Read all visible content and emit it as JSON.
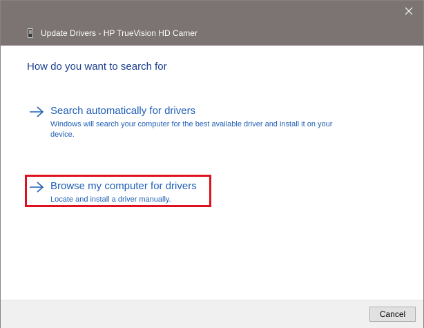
{
  "window": {
    "title": "Update Drivers - HP TrueVision HD Camer",
    "title_icon": "device-icon",
    "close_icon": "close-icon"
  },
  "main": {
    "heading": "How do you want to search for",
    "options": [
      {
        "icon": "arrow-right-icon",
        "title": "Search automatically for drivers",
        "description": "Windows will search your computer for the best available driver and install it on your device."
      },
      {
        "icon": "arrow-right-icon",
        "title": "Browse my computer for drivers",
        "description": "Locate and install a driver manually.",
        "highlighted": true
      }
    ]
  },
  "footer": {
    "cancel_label": "Cancel"
  },
  "colors": {
    "titlebar": "#7b7472",
    "heading": "#1a3f8e",
    "link": "#1f5fb5",
    "highlight": "#e0101e",
    "footer": "#f0f0f0"
  }
}
